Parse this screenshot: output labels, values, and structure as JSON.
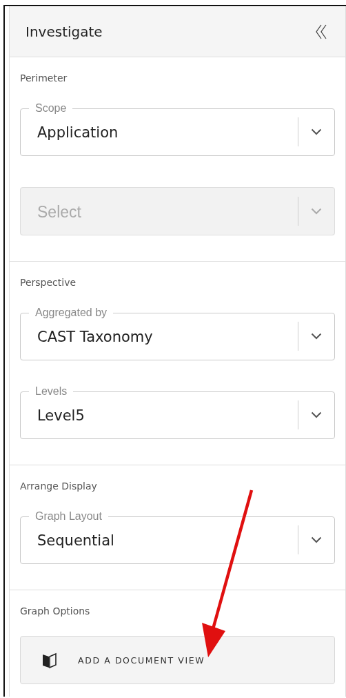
{
  "panel": {
    "title": "Investigate"
  },
  "sections": [
    {
      "title": "Perimeter",
      "fields": [
        {
          "label": "Scope",
          "value": "Application",
          "disabled": false
        },
        {
          "placeholder": "Select",
          "disabled": true
        }
      ]
    },
    {
      "title": "Perspective",
      "fields": [
        {
          "label": "Aggregated by",
          "value": "CAST Taxonomy",
          "disabled": false
        },
        {
          "label": "Levels",
          "value": "Level5",
          "disabled": false
        }
      ]
    },
    {
      "title": "Arrange Display",
      "fields": [
        {
          "label": "Graph Layout",
          "value": "Sequential",
          "disabled": false
        }
      ]
    },
    {
      "title": "Graph Options",
      "button": {
        "label": "ADD A DOCUMENT VIEW"
      }
    }
  ]
}
